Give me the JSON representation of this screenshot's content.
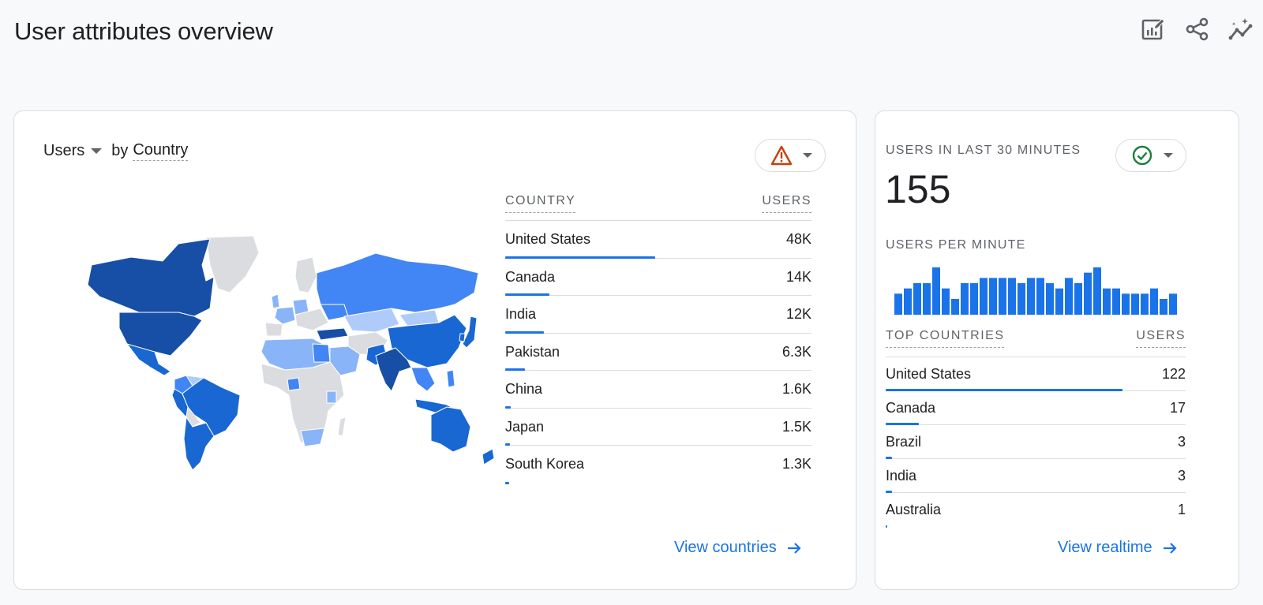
{
  "header": {
    "title": "User attributes overview",
    "actions": [
      {
        "icon": "edit-report-icon",
        "label": "Customize report"
      },
      {
        "icon": "share-icon",
        "label": "Share"
      },
      {
        "icon": "insights-icon",
        "label": "Insights"
      }
    ]
  },
  "country_card": {
    "metric": "Users",
    "by": "by",
    "dimension": "Country",
    "status_icon": "warning-icon",
    "status_color": "#c5400b",
    "table": {
      "headers": [
        "COUNTRY",
        "USERS"
      ],
      "rows": [
        {
          "name": "United States",
          "value": "48K",
          "share": 0.49
        },
        {
          "name": "Canada",
          "value": "14K",
          "share": 0.145
        },
        {
          "name": "India",
          "value": "12K",
          "share": 0.125
        },
        {
          "name": "Pakistan",
          "value": "6.3K",
          "share": 0.065
        },
        {
          "name": "China",
          "value": "1.6K",
          "share": 0.017
        },
        {
          "name": "Japan",
          "value": "1.5K",
          "share": 0.016
        },
        {
          "name": "South Korea",
          "value": "1.3K",
          "share": 0.014
        }
      ]
    },
    "link": "View countries",
    "map_colors": {
      "highest": "#174ea6",
      "high": "#1967d2",
      "mid": "#4285f4",
      "low": "#8ab4f8",
      "lowest": "#aecbfa",
      "none": "#dadce0"
    }
  },
  "realtime_card": {
    "label": "USERS IN LAST 30 MINUTES",
    "value": "155",
    "status_icon": "check-circle-icon",
    "status_color": "#188038",
    "per_minute_label": "USERS PER MINUTE",
    "chart_data": {
      "type": "bar",
      "title": "USERS PER MINUTE",
      "values": [
        4,
        5,
        6,
        6,
        9,
        5,
        3,
        6,
        6,
        7,
        7,
        7,
        7,
        6,
        7,
        7,
        6,
        5,
        7,
        6,
        8,
        9,
        5,
        5,
        4,
        4,
        4,
        5,
        3,
        4
      ],
      "color": "#1a73e8"
    },
    "table": {
      "headers": [
        "TOP COUNTRIES",
        "USERS"
      ],
      "rows": [
        {
          "name": "United States",
          "value": "122",
          "share": 0.79
        },
        {
          "name": "Canada",
          "value": "17",
          "share": 0.11
        },
        {
          "name": "Brazil",
          "value": "3",
          "share": 0.02
        },
        {
          "name": "India",
          "value": "3",
          "share": 0.02
        },
        {
          "name": "Australia",
          "value": "1",
          "share": 0.006
        }
      ]
    },
    "link": "View realtime"
  }
}
